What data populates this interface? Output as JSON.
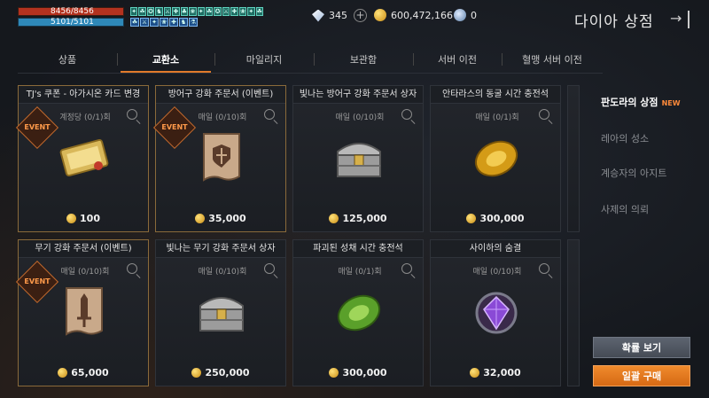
{
  "status": {
    "hp": "8456/8456",
    "mp": "5101/5101",
    "buff_row1": [
      "✦",
      "☘",
      "✪",
      "♞",
      "⚔",
      "✚",
      "♣",
      "❀",
      "✦",
      "☘",
      "✪",
      "⚔",
      "✚",
      "❀",
      "✦",
      "☘"
    ],
    "buff_row2": [
      "☘",
      "⚔",
      "✦",
      "❀",
      "✚",
      "♞",
      "⚗"
    ]
  },
  "currency": {
    "diamond": "345",
    "gold": "600,472,166",
    "crystal": "0"
  },
  "shop": {
    "title": "다이아 상점"
  },
  "tabs": [
    {
      "label": "상품"
    },
    {
      "label": "교환소"
    },
    {
      "label": "마일리지"
    },
    {
      "label": "보관함"
    },
    {
      "label": "서버 이전"
    },
    {
      "label": "혈맹 서버 이전"
    }
  ],
  "items": [
    {
      "title": "TJ's 쿠폰 - 아가시온 카드 변경",
      "limit": "계정당 (0/1)회",
      "price": "100",
      "event": "EVENT",
      "icon": "coupon-icon"
    },
    {
      "title": "방어구 강화 주문서 (이벤트)",
      "limit": "매일 (0/10)회",
      "price": "35,000",
      "event": "EVENT",
      "icon": "armor-scroll-icon"
    },
    {
      "title": "빛나는 방어구 강화 주문서 상자",
      "limit": "매일 (0/10)회",
      "price": "125,000",
      "icon": "chest-icon"
    },
    {
      "title": "안타라스의 동굴 시간 충전석",
      "limit": "매일 (0/1)회",
      "price": "300,000",
      "icon": "gold-stone-icon"
    },
    {
      "title": "무기 강화 주문서 (이벤트)",
      "limit": "매일 (0/10)회",
      "price": "65,000",
      "event": "EVENT",
      "icon": "weapon-scroll-icon"
    },
    {
      "title": "빛나는 무기 강화 주문서 상자",
      "limit": "매일 (0/10)회",
      "price": "250,000",
      "icon": "chest-icon"
    },
    {
      "title": "파괴된 성채 시간 충전석",
      "limit": "매일 (0/1)회",
      "price": "300,000",
      "icon": "green-stone-icon"
    },
    {
      "title": "사이하의 숨결",
      "limit": "매일 (0/10)회",
      "price": "32,000",
      "icon": "purple-gem-icon"
    }
  ],
  "side_menu": {
    "items": [
      {
        "label": "판도라의 상점",
        "badge": "NEW"
      },
      {
        "label": "레아의 성소"
      },
      {
        "label": "계승자의 아지트"
      },
      {
        "label": "사제의 의뢰"
      }
    ]
  },
  "buttons": {
    "probability": "확률 보기",
    "bulk_buy": "일괄 구매"
  }
}
